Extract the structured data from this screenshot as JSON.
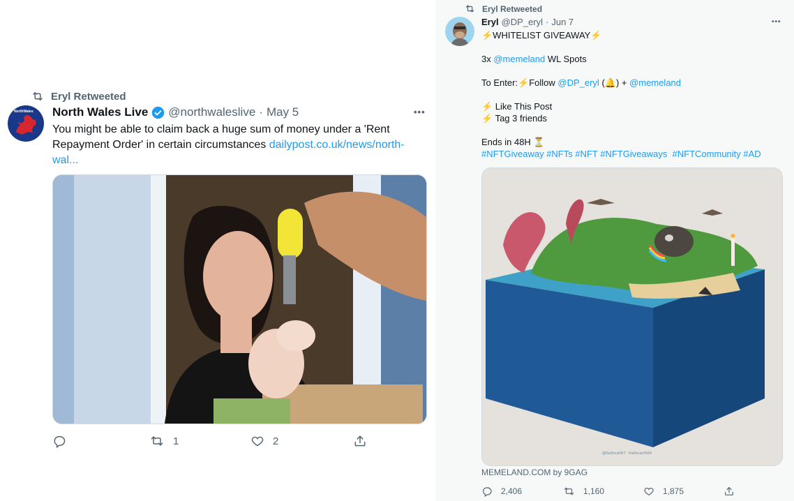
{
  "left_tweet": {
    "retweeted_by": "Eryl Retweeted",
    "avatar_text": "NorthWales",
    "author_name": "North Wales Live",
    "handle": "@northwaleslive",
    "sep": "·",
    "date": "May 5",
    "text": "You might be able to claim back a huge sum of money under a 'Rent Repayment Order' in certain circumstances ",
    "link": "dailypost.co.uk/news/north-wal...",
    "more": "•••",
    "replies": "",
    "retweets": "1",
    "likes": "2"
  },
  "right_tweet": {
    "retweeted_by": "Eryl Retweeted",
    "author_name": "Eryl",
    "handle": "@DP_eryl",
    "sep": "·",
    "date": "Jun 7",
    "more": "•••",
    "headline": "⚡WHITELIST GIVEAWAY⚡",
    "line2_prefix": "3x ",
    "line2_mention": "@memeland",
    "line2_suffix": " WL Spots",
    "enter_prefix": "To Enter:⚡Follow ",
    "enter_mention1": "@DP_eryl",
    "enter_mid": " (🔔) + ",
    "enter_mention2": "@memeland",
    "step1": "⚡ Like This Post",
    "step2": "⚡ Tag 3 friends",
    "ends": "Ends in 48H ⏳",
    "hashtags": "#NFTGiveaway #NFTs #NFT #NFTGiveaways  #NFTCommunity #AD",
    "card_source": "MEMELAND.COM by 9GAG",
    "image_credit": "@RaiDeusNFT   RaiDeus#3564",
    "replies": "2,406",
    "retweets": "1,160",
    "likes": "1,875"
  },
  "colors": {
    "accent": "#1d9bf0",
    "muted": "#536471",
    "panel": "#f7f9f9"
  }
}
